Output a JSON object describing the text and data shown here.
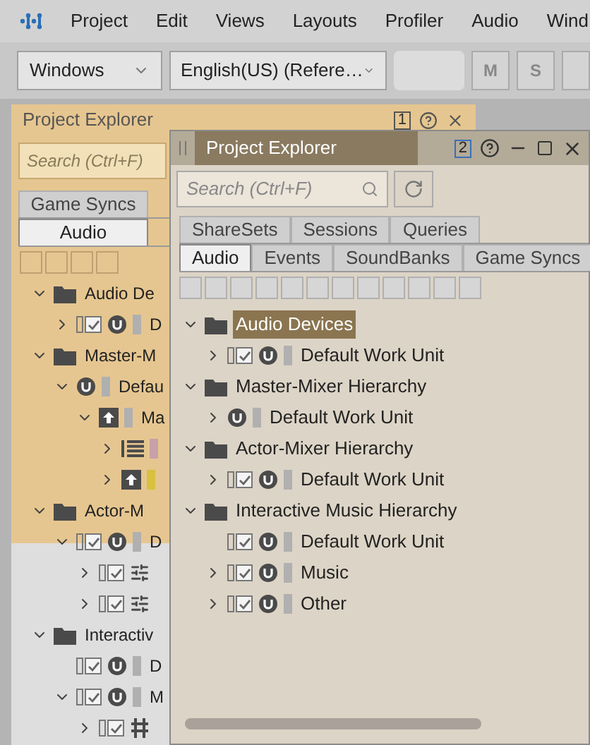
{
  "menu": [
    "Project",
    "Edit",
    "Views",
    "Layouts",
    "Profiler",
    "Audio",
    "Wind"
  ],
  "toolbar": {
    "platform": "Windows",
    "language": "English(US) (Refere…",
    "buttons": [
      "M",
      "S"
    ]
  },
  "docked_explorer": {
    "title": "Project Explorer",
    "badge": "1",
    "search": {
      "placeholder": "Search (Ctrl+F)"
    },
    "tab_rows": [
      [
        {
          "label": "Game Syncs",
          "selected": false
        }
      ],
      [
        {
          "label": "Audio",
          "selected": true
        }
      ]
    ],
    "tree": [
      {
        "label": "Audio De",
        "kind": "folder",
        "expanded": true,
        "children": [
          {
            "label": "D",
            "kind": "workunit",
            "expanded": false,
            "checked": true,
            "color": "#b0b0b0"
          }
        ]
      },
      {
        "label": "Master-M",
        "kind": "folder",
        "expanded": true,
        "children": [
          {
            "label": "Defau",
            "kind": "workunit",
            "expanded": true,
            "color": "#b0b0b0",
            "children": [
              {
                "label": "Ma",
                "kind": "bus",
                "expanded": true,
                "color": "#b0b0b0",
                "children": [
                  {
                    "kind": "auxbus",
                    "expanded": false,
                    "color": "#c8a0a8"
                  },
                  {
                    "kind": "bus",
                    "expanded": false,
                    "color": "#d8c040"
                  }
                ]
              }
            ]
          }
        ]
      },
      {
        "label": "Actor-M",
        "kind": "folder",
        "expanded": true,
        "children": [
          {
            "label": "D",
            "kind": "workunit",
            "expanded": true,
            "checked": true,
            "color": "#b0b0b0",
            "children": [
              {
                "kind": "actor",
                "expanded": false,
                "checked": true
              },
              {
                "kind": "actor",
                "expanded": false,
                "checked": true
              }
            ]
          }
        ]
      },
      {
        "label": "Interactiv",
        "kind": "folder",
        "expanded": true,
        "children": [
          {
            "label": "D",
            "kind": "workunit",
            "checked": true,
            "color": "#b0b0b0"
          },
          {
            "label": "M",
            "kind": "workunit",
            "expanded": true,
            "checked": true,
            "color": "#b0b0b0",
            "children": [
              {
                "kind": "music",
                "expanded": false,
                "checked": true
              }
            ]
          }
        ]
      }
    ]
  },
  "floating_explorer": {
    "title": "Project Explorer",
    "badge": "2",
    "search": {
      "placeholder": "Search (Ctrl+F)"
    },
    "tab_rows": [
      [
        {
          "label": "ShareSets",
          "selected": false
        },
        {
          "label": "Sessions",
          "selected": false
        },
        {
          "label": "Queries",
          "selected": false
        }
      ],
      [
        {
          "label": "Audio",
          "selected": true
        },
        {
          "label": "Events",
          "selected": false
        },
        {
          "label": "SoundBanks",
          "selected": false
        },
        {
          "label": "Game Syncs",
          "selected": false
        }
      ]
    ],
    "tree": [
      {
        "label": "Audio Devices",
        "kind": "folder",
        "expanded": true,
        "selected": true,
        "children": [
          {
            "label": "Default Work Unit",
            "kind": "workunit",
            "expanded": false,
            "checked": true,
            "selected": false,
            "color": "#b0b0b0"
          }
        ]
      },
      {
        "label": "Master-Mixer Hierarchy",
        "kind": "folder",
        "expanded": true,
        "selected": false,
        "children": [
          {
            "label": "Default Work Unit",
            "kind": "workunit",
            "expanded": false,
            "selected": false,
            "color": "#b0b0b0"
          }
        ]
      },
      {
        "label": "Actor-Mixer Hierarchy",
        "kind": "folder",
        "expanded": true,
        "selected": false,
        "children": [
          {
            "label": "Default Work Unit",
            "kind": "workunit",
            "expanded": false,
            "checked": true,
            "selected": false,
            "color": "#b0b0b0"
          }
        ]
      },
      {
        "label": "Interactive Music Hierarchy",
        "kind": "folder",
        "expanded": true,
        "selected": false,
        "children": [
          {
            "label": "Default Work Unit",
            "kind": "workunit",
            "checked": true,
            "selected": false,
            "color": "#b0b0b0"
          },
          {
            "label": "Music",
            "kind": "workunit",
            "expanded": false,
            "checked": true,
            "selected": false,
            "color": "#b0b0b0"
          },
          {
            "label": "Other",
            "kind": "workunit",
            "expanded": false,
            "checked": true,
            "selected": false,
            "color": "#b0b0b0"
          }
        ]
      }
    ]
  }
}
